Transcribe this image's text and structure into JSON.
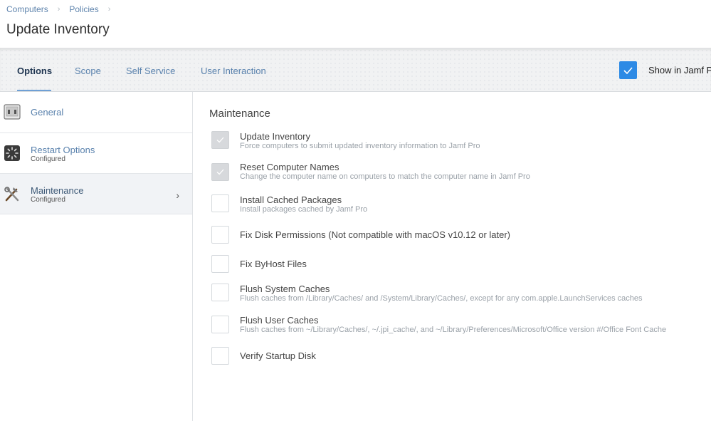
{
  "breadcrumb": {
    "items": [
      "Computers",
      "Policies"
    ],
    "separator": "›"
  },
  "page_title": "Update Inventory",
  "tabs": [
    {
      "label": "Options",
      "active": true
    },
    {
      "label": "Scope",
      "active": false
    },
    {
      "label": "Self Service",
      "active": false
    },
    {
      "label": "User Interaction",
      "active": false
    }
  ],
  "show_in_jamf": {
    "label": "Show in Jamf P",
    "checked": true
  },
  "sidebar": {
    "items": [
      {
        "label": "General",
        "sub": "",
        "icon": "general-icon"
      },
      {
        "label": "Restart Options",
        "sub": "Configured",
        "icon": "restart-icon"
      },
      {
        "label": "Maintenance",
        "sub": "Configured",
        "icon": "tools-icon",
        "active": true
      }
    ],
    "chevron": "›"
  },
  "main": {
    "section_title": "Maintenance",
    "options": [
      {
        "label": "Update Inventory",
        "desc": "Force computers to submit updated inventory information to Jamf Pro",
        "checked": true
      },
      {
        "label": "Reset Computer Names",
        "desc": "Change the computer name on computers to match the computer name in Jamf Pro",
        "checked": true
      },
      {
        "label": "Install Cached Packages",
        "desc": "Install packages cached by Jamf Pro",
        "checked": false
      },
      {
        "label": "Fix Disk Permissions (Not compatible with macOS v10.12 or later)",
        "desc": "",
        "checked": false
      },
      {
        "label": "Fix ByHost Files",
        "desc": "",
        "checked": false
      },
      {
        "label": "Flush System Caches",
        "desc": "Flush caches from /Library/Caches/ and /System/Library/Caches/, except for any com.apple.LaunchServices caches",
        "checked": false
      },
      {
        "label": "Flush User Caches",
        "desc": "Flush caches from ~/Library/Caches/, ~/.jpi_cache/, and ~/Library/Preferences/Microsoft/Office version #/Office Font Cache",
        "checked": false
      },
      {
        "label": "Verify Startup Disk",
        "desc": "",
        "checked": false
      }
    ]
  },
  "colors": {
    "accent": "#2d8ae5",
    "link": "#5a82ad",
    "tab_active_underline": "#6fa0d5"
  }
}
